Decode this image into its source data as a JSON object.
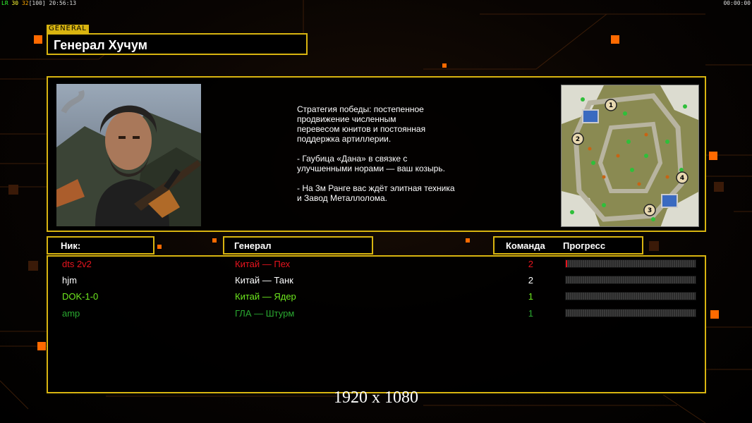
{
  "topbar": {
    "hud_left_1": "LR",
    "hud_left_2": "30",
    "hud_left_3": "32",
    "hud_left_4": "[100]",
    "clock": "20:56:13",
    "timer": "00:00:00"
  },
  "general": {
    "tag": "GENERAL",
    "name": "Генерал Хучум",
    "strategy": "Стратегия победы: постепенное\nпродвижение численным\nперевесом юнитов и постоянная\nподдержка артиллерии.\n\n- Гаубица «Дана» в связке с\nулучшенными норами — ваш козырь.\n\n- На 3м Ранге вас ждёт элитная техника\nи Завод Металлолома."
  },
  "minimap": {
    "start_positions": [
      "1",
      "2",
      "3",
      "4"
    ]
  },
  "table": {
    "col_nick": "Ник:",
    "col_general": "Генерал",
    "col_team": "Команда",
    "col_progress": "Прогресс"
  },
  "players": [
    {
      "nick": "dts 2v2",
      "general": "Китай — Пех",
      "team": "2",
      "progress": 0.01,
      "color": "#e8141e"
    },
    {
      "nick": "hjm",
      "general": "Китай — Танк",
      "team": "2",
      "progress": 0.0,
      "color": "#ffffff"
    },
    {
      "nick": "DOK-1-0",
      "general": "Китай — Ядер",
      "team": "1",
      "progress": 0.0,
      "color": "#6ee81e"
    },
    {
      "nick": "amp",
      "general": "ГЛА — Штурм",
      "team": "1",
      "progress": 0.0,
      "color": "#2aa830"
    }
  ],
  "resolution_label": "1920 x 1080",
  "colors": {
    "accent": "#d8b410",
    "background": "#000000",
    "orange_squares": "#ff6a00"
  }
}
